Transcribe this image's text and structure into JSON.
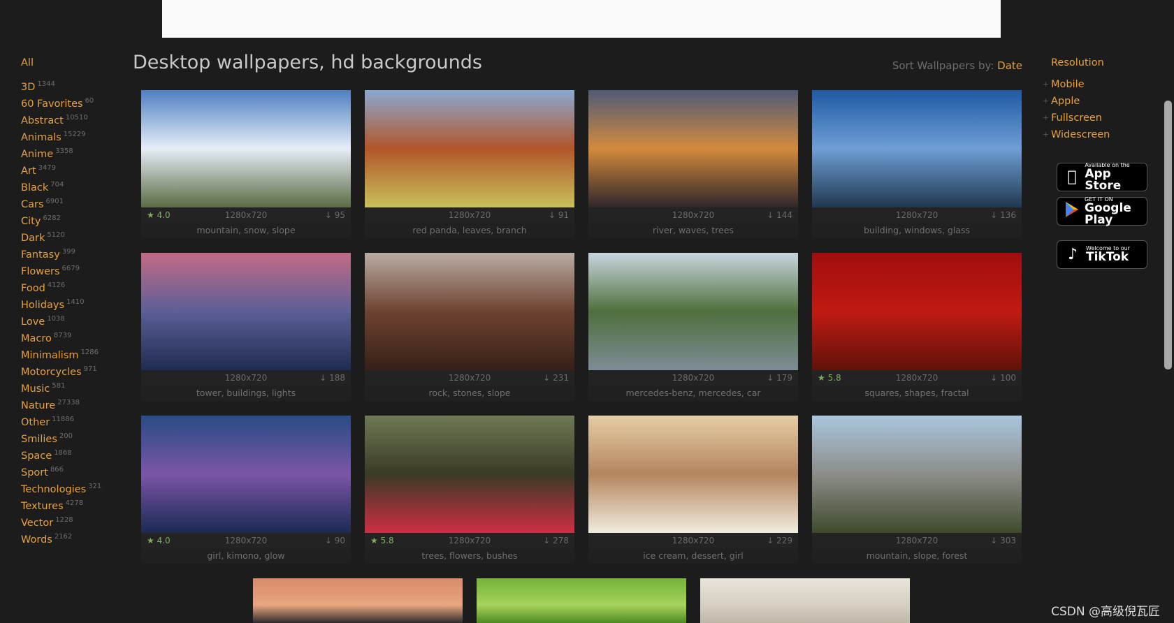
{
  "categories": [
    {
      "name": "3D",
      "count": "1344"
    },
    {
      "name": "60 Favorites",
      "count": "60"
    },
    {
      "name": "Abstract",
      "count": "10510"
    },
    {
      "name": "Animals",
      "count": "15229"
    },
    {
      "name": "Anime",
      "count": "3358"
    },
    {
      "name": "Art",
      "count": "3479"
    },
    {
      "name": "Black",
      "count": "704"
    },
    {
      "name": "Cars",
      "count": "6901"
    },
    {
      "name": "City",
      "count": "6282"
    },
    {
      "name": "Dark",
      "count": "5120"
    },
    {
      "name": "Fantasy",
      "count": "399"
    },
    {
      "name": "Flowers",
      "count": "6679"
    },
    {
      "name": "Food",
      "count": "4126"
    },
    {
      "name": "Holidays",
      "count": "1410"
    },
    {
      "name": "Love",
      "count": "1038"
    },
    {
      "name": "Macro",
      "count": "8739"
    },
    {
      "name": "Minimalism",
      "count": "1286"
    },
    {
      "name": "Motorcycles",
      "count": "971"
    },
    {
      "name": "Music",
      "count": "581"
    },
    {
      "name": "Nature",
      "count": "27338"
    },
    {
      "name": "Other",
      "count": "11886"
    },
    {
      "name": "Smilies",
      "count": "200"
    },
    {
      "name": "Space",
      "count": "1868"
    },
    {
      "name": "Sport",
      "count": "866"
    },
    {
      "name": "Technologies",
      "count": "321"
    },
    {
      "name": "Textures",
      "count": "4278"
    },
    {
      "name": "Vector",
      "count": "1228"
    },
    {
      "name": "Words",
      "count": "2162"
    }
  ],
  "sidebar": {
    "all_label": "All"
  },
  "header": {
    "title": "Desktop wallpapers, hd backgrounds",
    "sort_label": "Sort Wallpapers by:",
    "sort_value": "Date"
  },
  "wallpapers": [
    {
      "rating": "4.0",
      "res": "1280x720",
      "downloads": "95",
      "tags": "mountain, snow, slope",
      "colors": [
        "#4f7fc2",
        "#e6eef7",
        "#596b44"
      ]
    },
    {
      "rating": "",
      "res": "1280x720",
      "downloads": "91",
      "tags": "red panda, leaves, branch",
      "colors": [
        "#8aa9d1",
        "#b2562a",
        "#c8c05a"
      ]
    },
    {
      "rating": "",
      "res": "1280x720",
      "downloads": "144",
      "tags": "river, waves, trees",
      "colors": [
        "#4f5b77",
        "#d28a3d",
        "#30262a"
      ]
    },
    {
      "rating": "",
      "res": "1280x720",
      "downloads": "136",
      "tags": "building, windows, glass",
      "colors": [
        "#1f5aa4",
        "#6f9ed6",
        "#203850"
      ]
    },
    {
      "rating": "",
      "res": "1280x720",
      "downloads": "188",
      "tags": "tower, buildings, lights",
      "colors": [
        "#c36a86",
        "#5c5f96",
        "#1f2b52"
      ]
    },
    {
      "rating": "",
      "res": "1280x720",
      "downloads": "231",
      "tags": "rock, stones, slope",
      "colors": [
        "#b9aca4",
        "#6e4331",
        "#372018"
      ]
    },
    {
      "rating": "",
      "res": "1280x720",
      "downloads": "179",
      "tags": "mercedes-benz, mercedes, car",
      "colors": [
        "#c9d6de",
        "#4f6f3d",
        "#7e8c96"
      ]
    },
    {
      "rating": "5.8",
      "res": "1280x720",
      "downloads": "100",
      "tags": "squares, shapes, fractal",
      "colors": [
        "#a10e0e",
        "#c01a12",
        "#60120a"
      ]
    },
    {
      "rating": "4.0",
      "res": "1280x720",
      "downloads": "90",
      "tags": "girl, kimono, glow",
      "colors": [
        "#274c86",
        "#7b55a8",
        "#1b2a52"
      ]
    },
    {
      "rating": "5.8",
      "res": "1280x720",
      "downloads": "278",
      "tags": "trees, flowers, bushes",
      "colors": [
        "#6f7a55",
        "#3a3a25",
        "#cf2e44"
      ]
    },
    {
      "rating": "",
      "res": "1280x720",
      "downloads": "229",
      "tags": "ice cream, dessert, girl",
      "colors": [
        "#e5cda5",
        "#b4855f",
        "#f1ecdf"
      ]
    },
    {
      "rating": "",
      "res": "1280x720",
      "downloads": "303",
      "tags": "mountain, slope, forest",
      "colors": [
        "#a9c6de",
        "#8c8d8a",
        "#3f4a2c"
      ]
    }
  ],
  "bottom_previews": [
    {
      "colors": [
        "#d98a6a",
        "#e8a67f",
        "#2e2a2d"
      ]
    },
    {
      "colors": [
        "#76b33a",
        "#a5d25a",
        "#4e8a22"
      ]
    },
    {
      "colors": [
        "#e9e4da",
        "#d6cfc2",
        "#bfb7a8"
      ]
    }
  ],
  "right": {
    "heading": "Resolution",
    "items": [
      "Mobile",
      "Apple",
      "Fullscreen",
      "Widescreen"
    ],
    "app_store": {
      "small": "Available on the",
      "big": "App Store"
    },
    "google_play": {
      "small": "GET IT ON",
      "big": "Google Play"
    },
    "tiktok": {
      "small": "Welcome to our",
      "big": "TikTok"
    }
  },
  "watermark": "CSDN @高级倪瓦匠"
}
